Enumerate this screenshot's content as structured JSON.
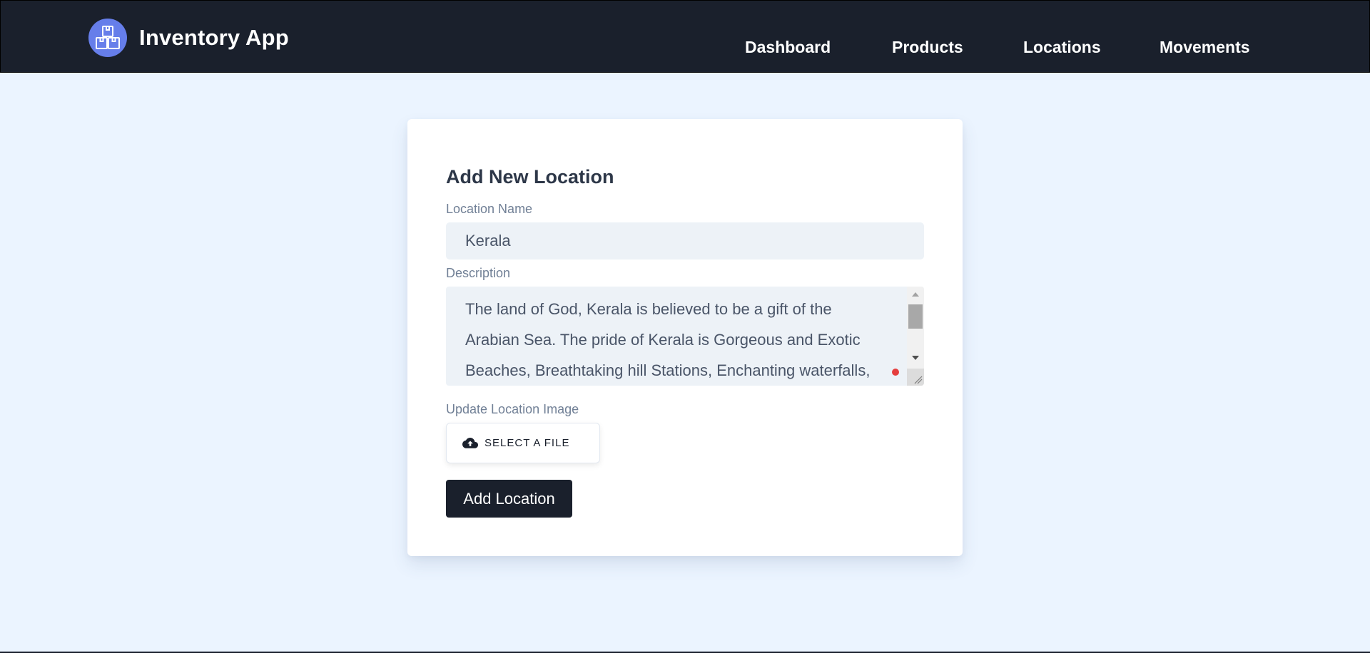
{
  "header": {
    "brand_title": "Inventory App",
    "logo_icon": "boxes-icon",
    "nav": [
      "Dashboard",
      "Products",
      "Locations",
      "Movements"
    ]
  },
  "form": {
    "title": "Add New Location",
    "name_label": "Location Name",
    "name_value": "Kerala",
    "description_label": "Description",
    "description_value": "The land of God, Kerala is believed to be a gift of the Arabian Sea. The pride of Kerala is Gorgeous and Exotic Beaches, Breathtaking hill Stations, Enchanting waterfalls, Beautiful",
    "image_label": "Update Location Image",
    "file_button_label": "SELECT A FILE",
    "file_button_icon": "cloud-upload-icon",
    "submit_label": "Add Location"
  },
  "colors": {
    "navbar_bg": "#1a202c",
    "page_bg": "#ebf4ff",
    "accent": "#667eea",
    "input_bg": "#edf2f7",
    "indicator_red": "#e53e3e"
  }
}
